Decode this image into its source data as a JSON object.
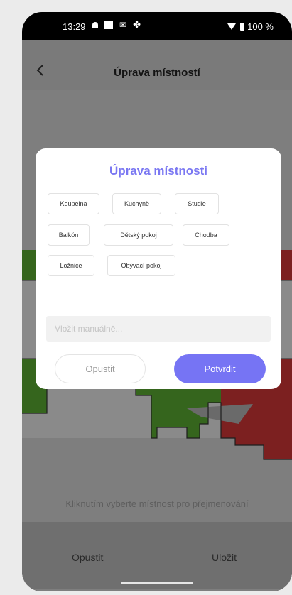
{
  "status_bar": {
    "time": "13:29",
    "battery": "100 %",
    "icons": [
      "notification-bell-icon",
      "square-icon",
      "gmail-icon",
      "fan-icon",
      "wifi-icon",
      "battery-icon"
    ]
  },
  "header": {
    "title": "Úprava místností",
    "back_icon": "chevron-left-icon"
  },
  "map": {
    "room_colors": {
      "green": "#35651d",
      "red": "#7c2020"
    }
  },
  "hint_text": "Kliknutím vyberte místnost pro přejmenování",
  "bottom_bar": {
    "cancel_label": "Opustit",
    "save_label": "Uložit"
  },
  "dialog": {
    "title": "Úprava místnosti",
    "room_names": [
      "Koupelna",
      "Kuchyně",
      "Studie",
      "Balkón",
      "Dětský pokoj",
      "Chodba",
      "Ložnice",
      "Obývací pokoj"
    ],
    "input_placeholder": "Vložit manuálně...",
    "input_value": "",
    "cancel_label": "Opustit",
    "confirm_label": "Potvrdit",
    "accent_color": "#7674f4"
  }
}
